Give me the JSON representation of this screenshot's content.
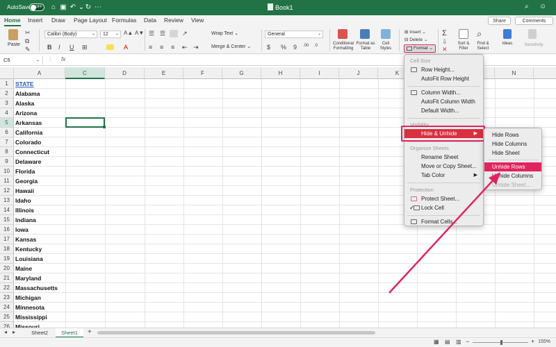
{
  "titlebar": {
    "autosave_label": "AutoSave",
    "autosave_state": "OFF",
    "doc_title": "Book1"
  },
  "tabs": [
    "Home",
    "Insert",
    "Draw",
    "Page Layout",
    "Formulas",
    "Data",
    "Review",
    "View"
  ],
  "share_label": "Share",
  "comments_label": "Comments",
  "ribbon": {
    "paste_label": "Paste",
    "font_name": "Calibri (Body)",
    "font_size": "12",
    "bold": "B",
    "italic": "I",
    "underline": "U",
    "wrap_text": "Wrap Text",
    "merge_center": "Merge & Center",
    "number_format": "General",
    "currency": "$",
    "percent": "%",
    "comma": "9",
    "dec_inc": ".00",
    "dec_dec": ".0",
    "conditional_formatting": "Conditional Formatting",
    "format_as_table": "Format as Table",
    "cell_styles": "Cell Styles",
    "insert": "Insert",
    "delete": "Delete",
    "format": "Format",
    "sort_filter": "Sort & Filter",
    "find_select": "Find & Select",
    "ideas": "Ideas",
    "sensitivity": "Sensitivity",
    "autosum": "Σ"
  },
  "namebox": "C5",
  "fx": "fx",
  "columns": [
    "A",
    "C",
    "D",
    "E",
    "F",
    "G",
    "H",
    "I",
    "J",
    "K",
    "L",
    "M",
    "N"
  ],
  "rows": [
    "1",
    "2",
    "3",
    "4",
    "5",
    "6",
    "7",
    "8",
    "9",
    "10",
    "11",
    "12",
    "13",
    "14",
    "15",
    "16",
    "17",
    "18",
    "19",
    "20",
    "21",
    "22",
    "23",
    "24",
    "25",
    "26"
  ],
  "cells_a": [
    "STATE",
    "Alabama",
    "Alaska",
    "Arizona",
    "Arkansas",
    "California",
    "Colorado",
    "Connecticut",
    "Delaware",
    "Florida",
    "Georgia",
    "Hawaii",
    "Idaho",
    "Illinois",
    "Indiana",
    "Iowa",
    "Kansas",
    "Kentucky",
    "Louisiana",
    "Maine",
    "Maryland",
    "Massachusetts",
    "Michigan",
    "Minnesota",
    "Mississippi",
    "Missouri"
  ],
  "sheets": [
    "Sheet2",
    "Sheet1"
  ],
  "add_sheet": "+",
  "zoom": "155%",
  "format_menu": {
    "cell_size": "Cell Size",
    "row_height": "Row Height...",
    "autofit_row": "AutoFit Row Height",
    "column_width": "Column Width...",
    "autofit_column": "AutoFit Column Width",
    "default_width": "Default Width...",
    "visibility": "Visibility",
    "hide_unhide": "Hide & Unhide",
    "organize_sheets": "Organize Sheets",
    "rename_sheet": "Rename Sheet",
    "move_copy": "Move or Copy Sheet...",
    "tab_color": "Tab Color",
    "protection": "Protection",
    "protect_sheet": "Protect Sheet...",
    "lock_cell": "Lock Cell",
    "format_cells": "Format Cells..."
  },
  "submenu": {
    "hide_rows": "Hide Rows",
    "hide_columns": "Hide Columns",
    "hide_sheet": "Hide Sheet",
    "unhide_rows": "Unhide Rows",
    "unhide_columns": "Unhide Columns",
    "unhide_sheet": "Unhide Sheet..."
  },
  "colors": {
    "excel_green": "#217346",
    "highlight": "#e0245e"
  }
}
